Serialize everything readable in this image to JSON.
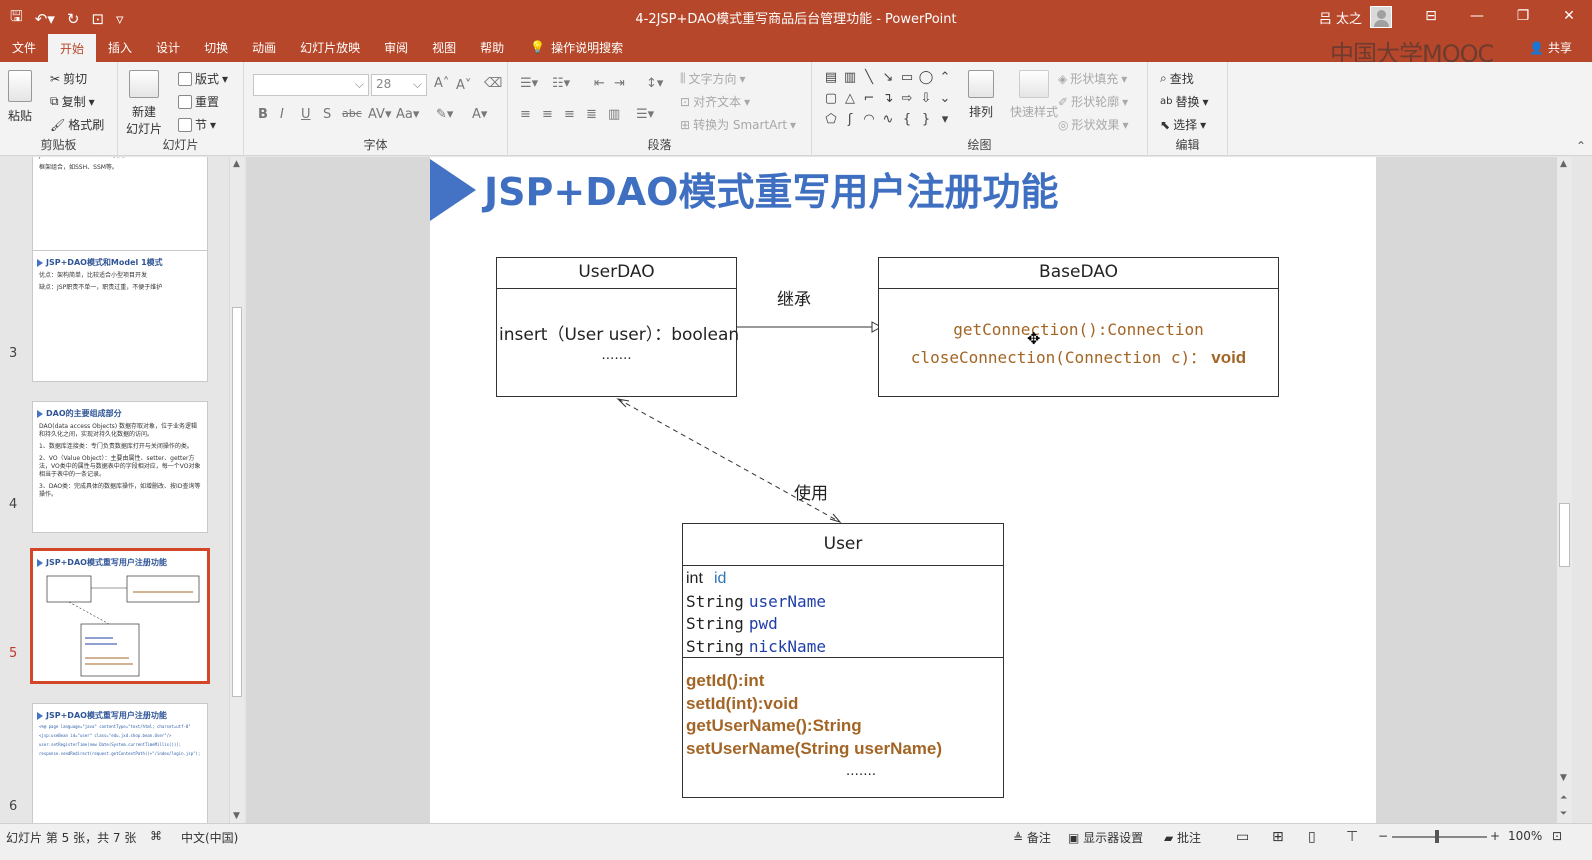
{
  "window": {
    "title": "4-2JSP+DAO模式重写商品后台管理功能  -  PowerPoint",
    "user": "吕 太之",
    "qat": [
      "save-icon",
      "undo-icon",
      "redo-icon",
      "present-icon",
      "customize-icon"
    ]
  },
  "tabs": [
    "文件",
    "开始",
    "插入",
    "设计",
    "切换",
    "动画",
    "幻灯片放映",
    "审阅",
    "视图",
    "帮助"
  ],
  "active_tab": "开始",
  "tell_me": "操作说明搜索",
  "watermark": "中国大学MOOC",
  "share": "共享",
  "ribbon": {
    "clipboard": {
      "label": "剪贴板",
      "paste": "粘贴",
      "cut": "剪切",
      "copy": "复制",
      "format_painter": "格式刷"
    },
    "slides": {
      "label": "幻灯片",
      "new_slide": "新建\n幻灯片",
      "layout": "版式",
      "reset": "重置",
      "section": "节"
    },
    "font": {
      "label": "字体",
      "font_name": "",
      "font_size": "28"
    },
    "paragraph": {
      "label": "段落",
      "text_direction": "文字方向",
      "align_text": "对齐文本",
      "smartart": "转换为 SmartArt"
    },
    "drawing": {
      "label": "绘图",
      "arrange": "排列",
      "quick_styles": "快速样式",
      "shape_fill": "形状填充",
      "shape_outline": "形状轮廓",
      "shape_effects": "形状效果"
    },
    "editing": {
      "label": "编辑",
      "find": "查找",
      "replace": "替换",
      "select": "选择"
    }
  },
  "thumbnails": [
    {
      "num": "",
      "lines": [
        "JSP+Servlet+DAO（MVC模式）",
        "框架组合，如SSH、SSM等。"
      ]
    },
    {
      "num": "3",
      "title": "JSP+DAO模式和Model 1模式",
      "lines": [
        "优点：架构简单，比较适合小型项目开发",
        "缺点：JSP职责不单一，职责过重，不便于维护"
      ]
    },
    {
      "num": "4",
      "title": "DAO的主要组成部分",
      "lines": [
        "DAO(data access Objects) 数据存取对象，位于业务逻辑和持久化之间，实现对持久化数据的访问。",
        "1、数据库连接类：专门负责数据库打开与关闭操作的类。",
        "2、VO（Value Object）：主要由属性、setter、getter方法，VO类中的属性与数据表中的字段相对应，每一个VO对象相当于表中的一条记录。",
        "3、DAO类：完成具体的数据库操作，如增删改、按ID查询等操作。"
      ]
    },
    {
      "num": "5",
      "title": "JSP+DAO模式重写用户注册功能",
      "lines": []
    },
    {
      "num": "6",
      "title": "JSP+DAO模式重写用户注册功能",
      "lines": [
        "<%@ page language=\"java\" contentType=\"text/html; charset=utf-8\"",
        "<jsp:useBean id=\"user\" class=\"edu.jxd.shop.bean.User\"/>",
        "user.setRegisterTime(new Date(System.currentTimeMillis()));",
        "response.sendRedirect(request.getContextPath()+\"/index/login.jsp\");"
      ]
    }
  ],
  "slide": {
    "title": "JSP+DAO模式重写用户注册功能",
    "userdao": {
      "name": "UserDAO",
      "method": "insert（User user）：boolean",
      "more": "……."
    },
    "basedao": {
      "name": "BaseDAO",
      "m1": "getConnection():Connection",
      "m2": "closeConnection(Connection c)：",
      "m2_ret": "void"
    },
    "inherit_label": "继承",
    "use_label": "使用",
    "user": {
      "name": "User",
      "fields": [
        {
          "type": "int",
          "name": "id"
        },
        {
          "type": "String",
          "name": "userName"
        },
        {
          "type": "String",
          "name": "pwd"
        },
        {
          "type": "String",
          "name": "nickName"
        }
      ],
      "methods": [
        "getId():int",
        "setId(int):void",
        "getUserName():String",
        "setUserName(String userName)"
      ],
      "more": "……."
    }
  },
  "status": {
    "slide_info": "幻灯片 第 5 张，共 7 张",
    "language": "中文(中国)",
    "notes": "备注",
    "display_settings": "显示器设置",
    "comments": "批注",
    "zoom_percent": "100%",
    "zoom_level": 0.47
  }
}
